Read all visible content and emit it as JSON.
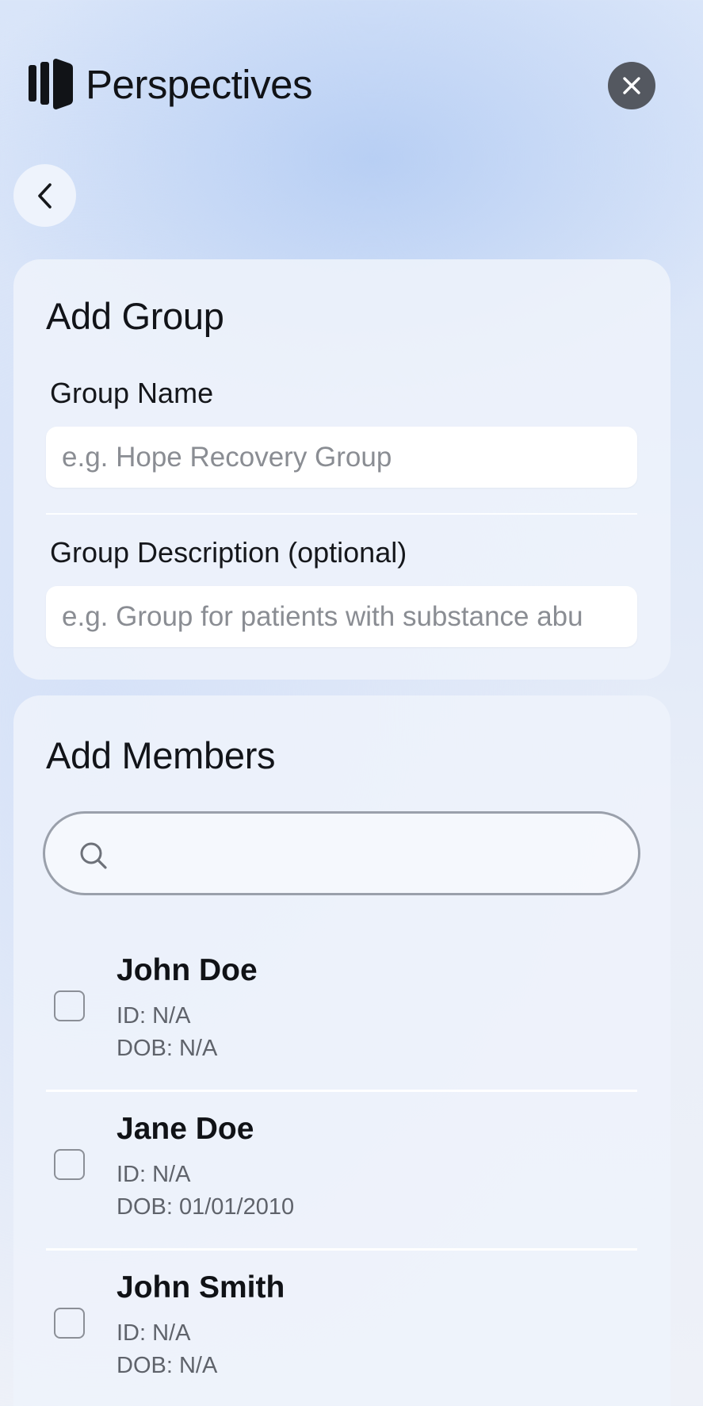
{
  "app": {
    "title": "Perspectives",
    "logo_icon": "perspectives-logo-icon",
    "close_icon": "close-icon",
    "back_icon": "chevron-left-icon"
  },
  "group_card": {
    "title": "Add Group",
    "name_label": "Group Name",
    "name_placeholder": "e.g. Hope Recovery Group",
    "name_value": "",
    "description_label": "Group Description (optional)",
    "description_placeholder": "e.g. Group for patients with substance abu",
    "description_value": ""
  },
  "members_card": {
    "title": "Add Members",
    "search_icon": "search-icon",
    "search_value": "",
    "members": [
      {
        "name": "John Doe",
        "id": "ID: N/A",
        "dob": "DOB: N/A",
        "checked": false
      },
      {
        "name": "Jane Doe",
        "id": "ID: N/A",
        "dob": "DOB: 01/01/2010",
        "checked": false
      },
      {
        "name": "John Smith",
        "id": "ID: N/A",
        "dob": "DOB: N/A",
        "checked": false
      }
    ]
  },
  "colors": {
    "close_button_bg": "#545860",
    "text_primary": "#111317",
    "text_secondary": "#5f636b",
    "placeholder": "#8a8d93",
    "search_border": "#9aa0ab"
  }
}
